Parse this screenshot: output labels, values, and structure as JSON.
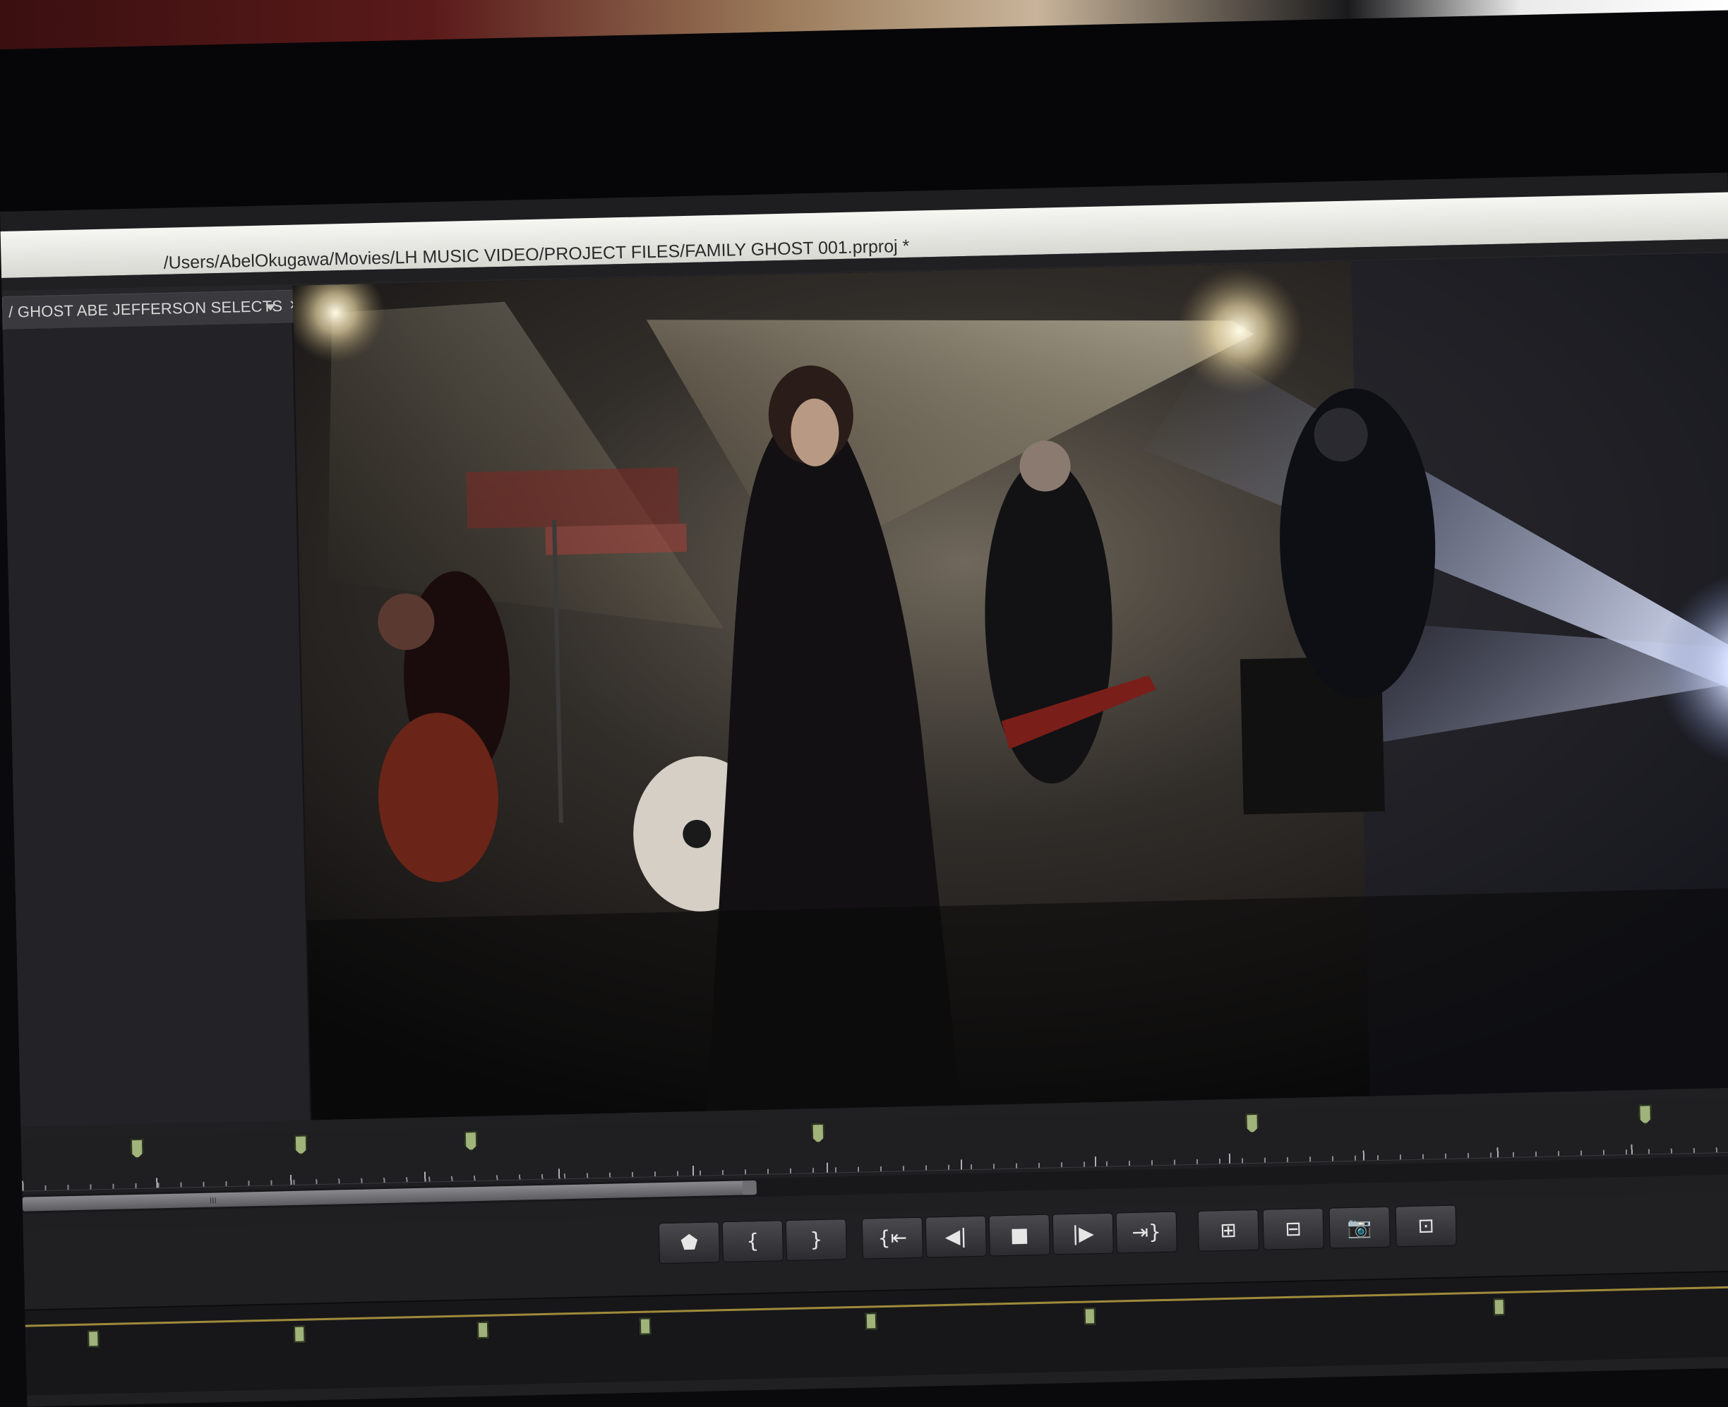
{
  "window": {
    "title_path": "/Users/AbelOkugawa/Movies/LH MUSIC VIDEO/PROJECT FILES/FAMILY GHOST 001.prproj *"
  },
  "source_monitor": {
    "tab_label": "/ GHOST ABE JEFFERSON SELECTS",
    "menu_icon": "chevron-down-icon",
    "close_glyph": "×"
  },
  "timeline": {
    "zoom_grip_glyph": "III"
  },
  "transport": {
    "buttons": [
      {
        "name": "add-marker",
        "glyph": "⬟"
      },
      {
        "name": "mark-in",
        "glyph": "{"
      },
      {
        "name": "mark-out",
        "glyph": "}"
      },
      {
        "name": "go-to-in",
        "glyph": "{⇤"
      },
      {
        "name": "step-back",
        "glyph": "◀|"
      },
      {
        "name": "stop",
        "glyph": "■"
      },
      {
        "name": "step-forward",
        "glyph": "|▶"
      },
      {
        "name": "go-to-out",
        "glyph": "⇥}"
      },
      {
        "name": "insert",
        "glyph": "⊞"
      },
      {
        "name": "overwrite",
        "glyph": "⊟"
      },
      {
        "name": "export-frame",
        "glyph": "📷"
      },
      {
        "name": "button-editor",
        "glyph": "⊡"
      }
    ]
  },
  "colors": {
    "marker": "#9fb37a",
    "panel": "#202023",
    "titlebar": "#e6e6e1"
  }
}
